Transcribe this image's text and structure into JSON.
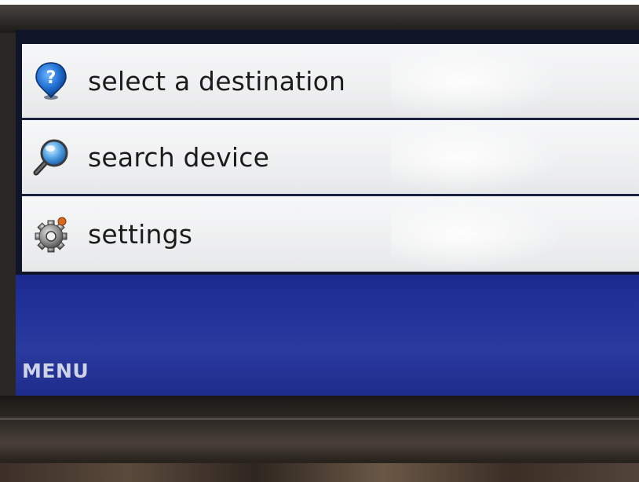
{
  "menu": {
    "title": "MENU",
    "items": [
      {
        "label": "select a destination",
        "icon": "question-pin-icon"
      },
      {
        "label": "search device",
        "icon": "magnifier-icon"
      },
      {
        "label": "settings",
        "icon": "gear-icon"
      }
    ]
  },
  "colors": {
    "panel_blue": "#213399",
    "item_background": "#eeeff0",
    "separator": "#1a2140",
    "icon_blue": "#1f6fd1"
  }
}
